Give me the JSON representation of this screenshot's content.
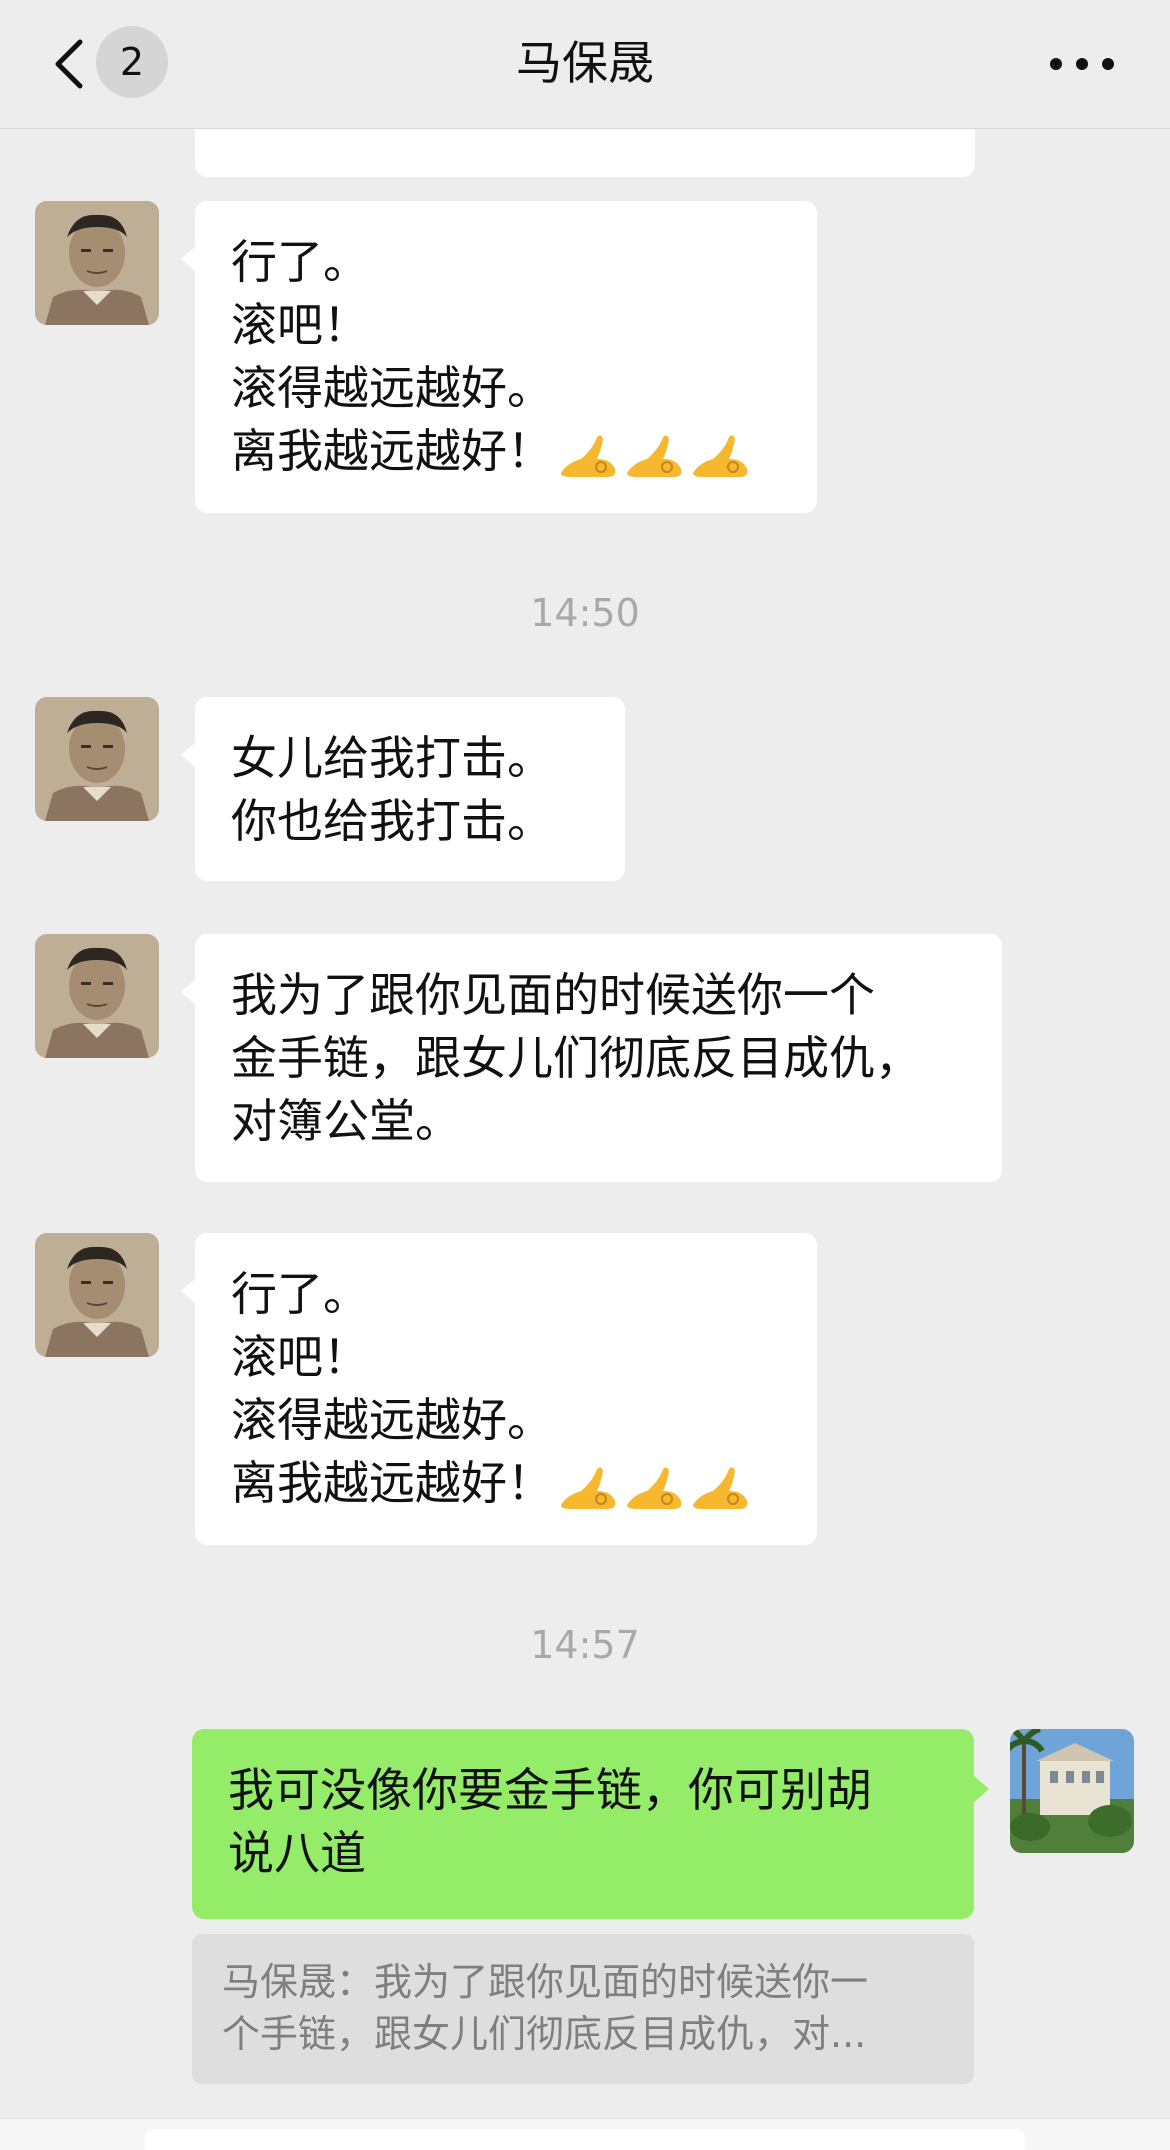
{
  "header": {
    "unread_count": "2",
    "title": "马保晟"
  },
  "messages": [
    {
      "id": "m1",
      "lines": [
        "行了。",
        "滚吧！",
        "滚得越远越好。",
        "离我越远越好！"
      ],
      "emoji": "ok-hand-emoji"
    },
    {
      "id": "m2",
      "lines": [
        "女儿给我打击。",
        "你也给我打击。"
      ]
    },
    {
      "id": "m3",
      "lines": [
        "我为了跟你见面的时候送你一个",
        "金手链，跟女儿们彻底反目成仇，",
        "对簿公堂。"
      ]
    },
    {
      "id": "m4",
      "lines": [
        "行了。",
        "滚吧！",
        "滚得越远越好。",
        "离我越远越好！"
      ],
      "emoji": "ok-hand-emoji"
    },
    {
      "id": "m5",
      "lines": [
        "我可没像你要金手链，你可别胡",
        "说八道"
      ]
    }
  ],
  "timestamps": [
    "14:50",
    "14:57"
  ],
  "quote": {
    "lines": [
      "马保晟：我为了跟你见面的时候送你一",
      "个手链，跟女儿们彻底反目成仇，对..."
    ]
  },
  "colors": {
    "background": "#ededed",
    "bubble_incoming": "#ffffff",
    "bubble_outgoing": "#95ec69",
    "timestamp": "#a9a9a9"
  }
}
